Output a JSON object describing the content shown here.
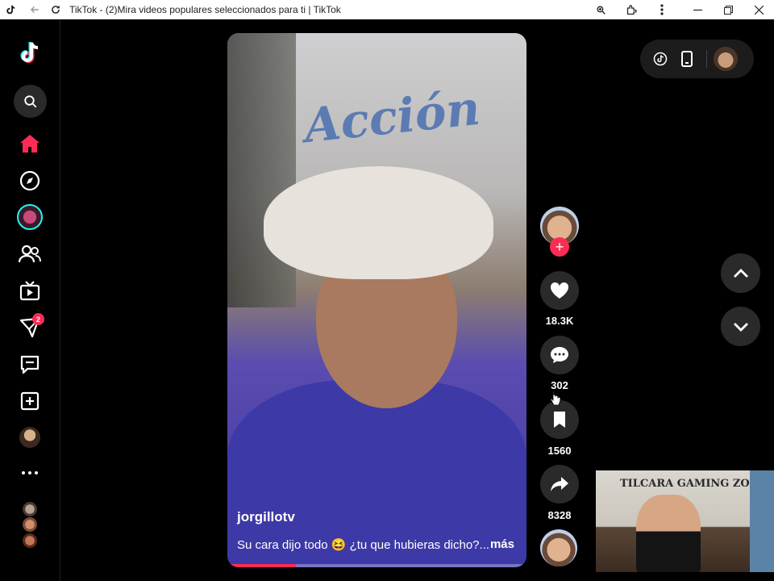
{
  "window": {
    "title": "TikTok - (2)Mira videos populares seleccionados para ti | TikTok"
  },
  "sidebar": {
    "inbox_badge": "2"
  },
  "video": {
    "username": "jorgillotv",
    "caption": "Su cara dijo todo 😆 ¿tu que hubieras dicho?...",
    "more_label": "más",
    "progress": 0.23
  },
  "actions": {
    "likes": "18.3K",
    "comments": "302",
    "saves": "1560",
    "shares": "8328"
  },
  "background": {
    "wall_text": "Acción",
    "cam_sign": "TILCARA GAMING ZO"
  },
  "colors": {
    "accent": "#fe2c55",
    "background": "#000000",
    "button_bg": "#2a2a2a"
  },
  "icons": {
    "sidebar": [
      "tiktok-logo-icon",
      "search-icon",
      "home-icon",
      "explore-icon",
      "live-icon",
      "following-icon",
      "live-tv-icon",
      "messages-icon",
      "activity-icon",
      "upload-icon",
      "profile-icon",
      "more-icon"
    ],
    "actions": [
      "heart-icon",
      "comment-icon",
      "bookmark-icon",
      "share-icon"
    ],
    "nav": [
      "chevron-up-icon",
      "chevron-down-icon"
    ]
  }
}
